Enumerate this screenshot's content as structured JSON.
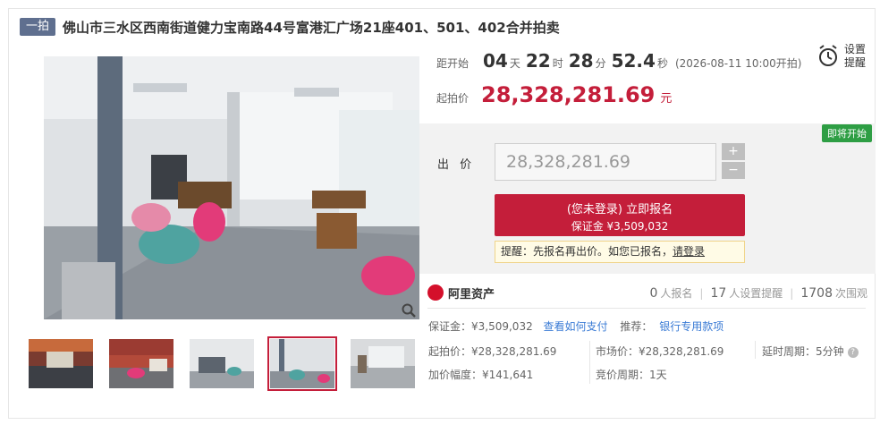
{
  "header": {
    "tag": "一拍",
    "title": "佛山市三水区西南街道健力宝南路44号富港汇广场21座401、501、402合并拍卖"
  },
  "gallery": {
    "thumb_count": 5,
    "active_thumb_index": 3
  },
  "countdown": {
    "label": "距开始",
    "days": "04",
    "days_unit": "天",
    "hours": "22",
    "hours_unit": "时",
    "minutes": "28",
    "minutes_unit": "分",
    "seconds": "52.4",
    "seconds_unit": "秒",
    "start_time": "(2026-08-11 10:00开拍)"
  },
  "reminder": {
    "line1": "设置",
    "line2": "提醒"
  },
  "start_price": {
    "label": "起拍价",
    "value": "28,328,281.69",
    "unit": "元"
  },
  "bid": {
    "badge": "即将开始",
    "label": "出 价",
    "input_value": "28,328,281.69",
    "plus": "+",
    "minus": "−",
    "signup_main": "(您未登录) 立即报名",
    "signup_sub": "保证金 ¥3,509,032",
    "hint_prefix": "提醒：先报名再出价。如您已报名，",
    "hint_link": "请登录"
  },
  "platform": {
    "name": "阿里资产",
    "signups": "0",
    "signups_label": "人报名",
    "reminders": "17",
    "reminders_label": "人设置提醒",
    "views": "1708",
    "views_label": "次围观"
  },
  "details": {
    "deposit": "保证金：¥3,509,032",
    "deposit_link": "查看如何支付",
    "recommend": "推荐：",
    "recommend_link": "银行专用款项",
    "start_price": "起拍价：¥28,328,281.69",
    "market_price": "市场价：¥28,328,281.69",
    "delay": "延时周期：5分钟",
    "increment": "加价幅度：¥141,641",
    "period": "竞价周期：1天"
  },
  "colors": {
    "accent": "#c41e3a",
    "tag_bg": "#5f6f8f",
    "badge_green": "#2e9e44",
    "link": "#3a7bd5"
  }
}
